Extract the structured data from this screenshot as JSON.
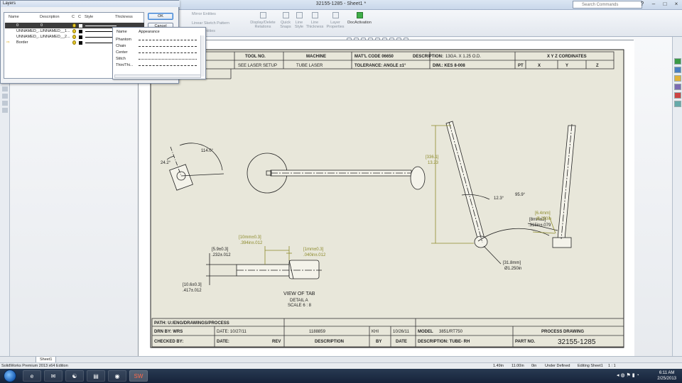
{
  "window": {
    "title": "32155-1285 - Sheet1 *",
    "search_placeholder": "Search Commands"
  },
  "ribbon": {
    "items": [
      {
        "label": "Mirror Entities"
      },
      {
        "label": "Linear Sketch Pattern"
      },
      {
        "label": "Move Entities"
      },
      {
        "label": "Display/Delete Relations"
      },
      {
        "label": "Quick Snaps"
      },
      {
        "label": "Line Style"
      },
      {
        "label": "Line Thickness"
      },
      {
        "label": "Layer Properties"
      },
      {
        "label": "DocActivation"
      }
    ]
  },
  "layers_dialog": {
    "title": "Layers",
    "columns": {
      "name": "Name",
      "description": "Description",
      "on": "C",
      "color": "C",
      "style": "Style",
      "thickness": "Thickness"
    },
    "rows": [
      {
        "name": "0",
        "description": "0"
      },
      {
        "name": "UNNAMED_...",
        "description": "UNNAMED__1..."
      },
      {
        "name": "UNNAMED_...",
        "description": "UNNAMED__2..."
      },
      {
        "name": "Border",
        "description": ""
      }
    ],
    "ok": "OK",
    "cancel": "Cancel",
    "style_dropdown": {
      "col_name": "Name",
      "col_appearance": "Appearance",
      "styles": [
        "Phantom",
        "Chain",
        "Center",
        "Stitch",
        "Thin/Thi..."
      ]
    }
  },
  "title_block_top": {
    "tool_no": "TOOL NO.",
    "machine": "MACHINE",
    "matl_code": "MAT'L CODE 06650",
    "description_label": "DESCRIPTION:",
    "description_value": "13GA. X 1.25 O.D.",
    "xyz": "X Y Z CORDINATES",
    "tool_value": "SEE LASER SETUP",
    "machine_value": "TUBE LASER",
    "tolerance": "TOLERANCE: ANGLE ±1°",
    "dim": "DIM.: KES 8-008",
    "pt": "PT",
    "x": "X",
    "y": "Y",
    "z": "Z"
  },
  "title_block_bottom": {
    "path": "PATH: U:/ENG/DRAWINGS/PROCESS",
    "drn_by": "DRN BY: WRS",
    "date1": "DATE: 10/27/11",
    "eco": "1188859",
    "khi": "KHI",
    "date2": "10/26/11",
    "model": "MODEL",
    "model_value": "3851/RT750",
    "process": "PROCESS DRAWING",
    "checked_by": "CHECKED BY:",
    "date_label": "DATE:",
    "rev": "REV",
    "description": "DESCRIPTION",
    "by": "BY",
    "date_col": "DATE",
    "description2": "DESCRIPTION: TUBE- RH",
    "part_no": "PART NO.",
    "part_no_value": "32155-1285"
  },
  "annotations": {
    "angle_114": "114.0°",
    "angle_24": "24.2°",
    "dim_336": "[336.1]",
    "dim_1323": "13.23",
    "angle_123": "12.3°",
    "angle_959": "95.9°",
    "dim_8mm": "[8mm±2]",
    "dim_315": ".315in±.079",
    "dim_64mm": "[6.4mm]",
    "dim_250in": "Ø.250in",
    "dim_318mm": "[31.8mm]",
    "dim_1250": "Ø1.250in",
    "dim_10mm": "[10mm±0.3]",
    "dim_394": ".394in±.012",
    "dim_59": "[5.9±0.3]",
    "dim_232": ".232±.012",
    "dim_1mm": "[1mm±0.3]",
    "dim_040": ".040in±.012",
    "dim_106": "[10.6±0.3]",
    "dim_417": ".417±.012",
    "view_of_tab": "VIEW OF TAB",
    "detail": "DETAIL A",
    "scale": "SCALE 6 : 8"
  },
  "sheet_tab": "Sheet1",
  "status": {
    "app": "SolidWorks Premium 2013 x64 Edition",
    "x": "1.49in",
    "y": "11.00in",
    "z": "0in",
    "state": "Under Defined",
    "editing": "Editing Sheet1",
    "scale": "1 : 1"
  },
  "taskbar": {
    "time": "6:11 AM",
    "date": "2/25/2013"
  },
  "colors": {
    "dimension_olive": "#8c8a2a",
    "sheet_bg": "#e8e7da",
    "taskbar": "#1d2d45"
  }
}
